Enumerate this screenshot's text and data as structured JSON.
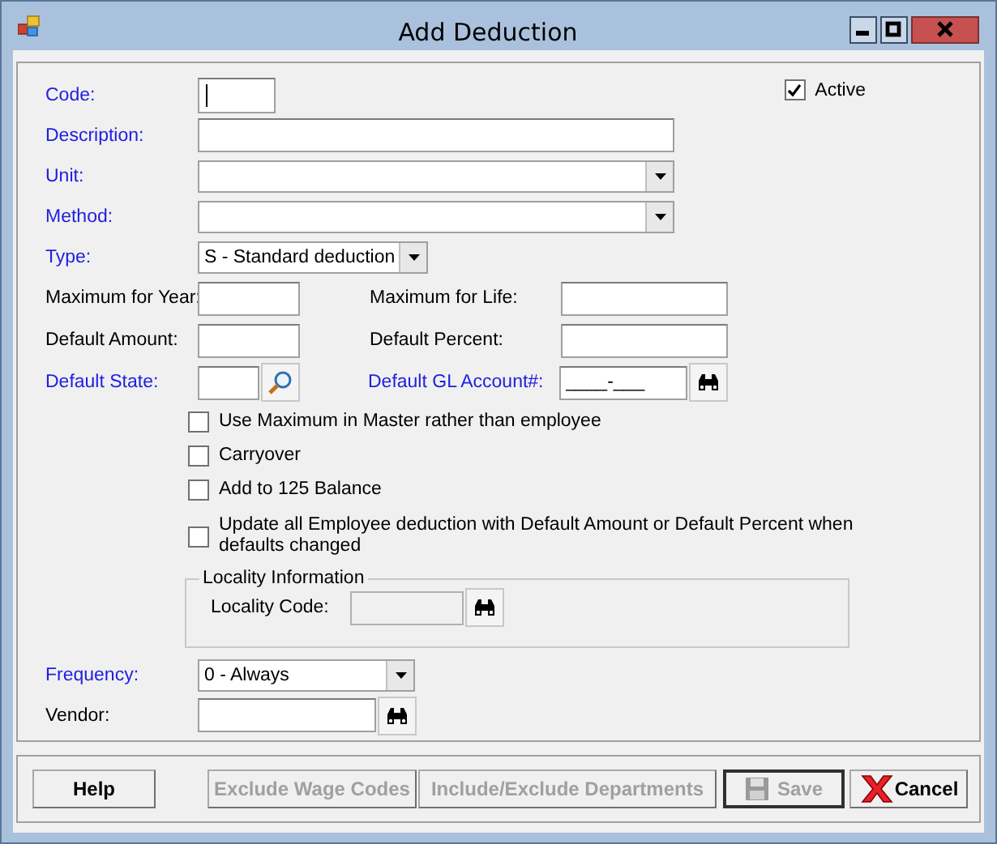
{
  "window": {
    "title": "Add Deduction"
  },
  "code": {
    "label": "Code:",
    "required": true,
    "focused": true
  },
  "active": {
    "label": "Active",
    "checked": true
  },
  "description": {
    "label": "Description:",
    "required": true
  },
  "unit": {
    "label": "Unit:",
    "required": true
  },
  "method": {
    "label": "Method:",
    "required": true
  },
  "type": {
    "label": "Type:",
    "required": true,
    "value": "S - Standard deduction"
  },
  "maximum_for_year": {
    "label": "Maximum for Year:",
    "required": false
  },
  "maximum_for_life": {
    "label": "Maximum for Life:",
    "required": false
  },
  "default_amount": {
    "label": "Default Amount:",
    "required": false
  },
  "default_percent": {
    "label": "Default Percent:",
    "required": false
  },
  "default_state": {
    "label": "Default State:",
    "required": true
  },
  "default_gl_account": {
    "label": "Default GL Account#:",
    "required": true,
    "value": "____-___"
  },
  "options": [
    {
      "label": "Use Maximum in Master rather than employee",
      "checked": false
    },
    {
      "label": "Carryover",
      "checked": false
    },
    {
      "label": "Add to 125 Balance",
      "checked": false
    },
    {
      "label": "Update all Employee deduction with Default Amount or Default Percent when defaults changed",
      "checked": false
    }
  ],
  "locality": {
    "title": "Locality Information",
    "label": "Locality Code:",
    "disabled": true
  },
  "frequency": {
    "label": "Frequency:",
    "required": true,
    "value": "0 - Always"
  },
  "vendor": {
    "label": "Vendor:",
    "required": false
  },
  "buttons": [
    {
      "label": "Help",
      "kind": "plain",
      "disabled": false
    },
    {
      "label": "Exclude Wage Codes",
      "kind": "plain",
      "disabled": true
    },
    {
      "label": "Include/Exclude Departments",
      "kind": "plain",
      "disabled": true
    },
    {
      "label": "Save",
      "kind": "save",
      "disabled": true
    },
    {
      "label": "Cancel",
      "kind": "cancel",
      "disabled": false
    }
  ]
}
